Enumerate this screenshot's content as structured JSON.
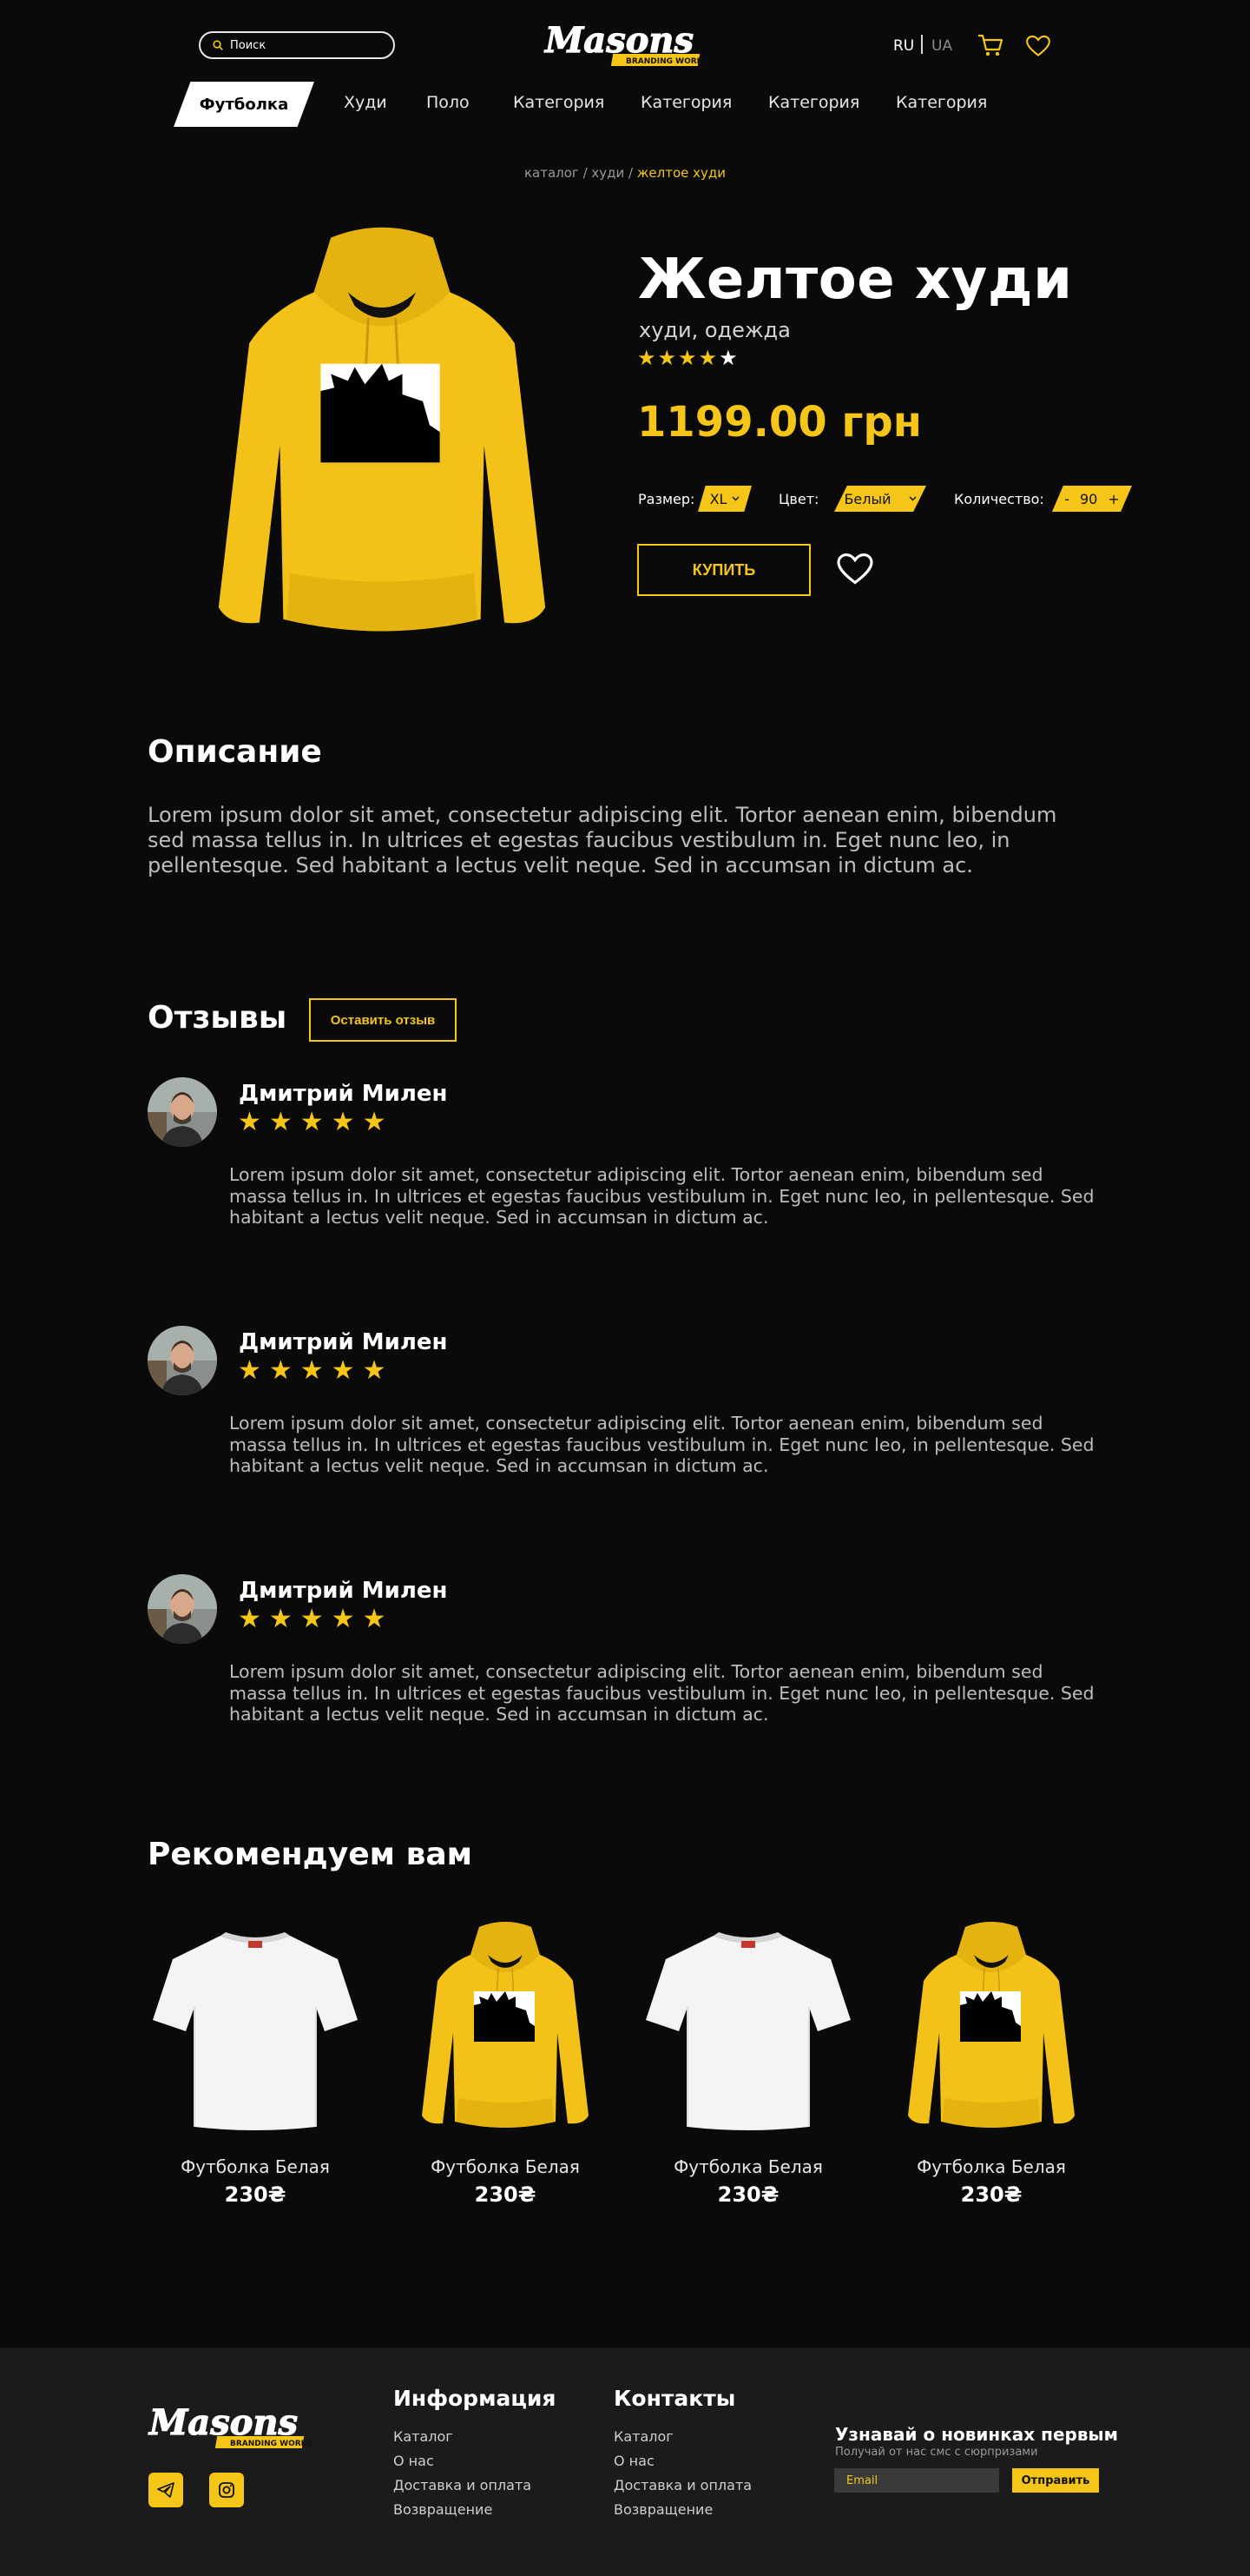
{
  "header": {
    "search_placeholder": "Поиск",
    "logo_text": "Masons",
    "logo_tagline": "BRANDING WORKSHOP",
    "lang_active": "RU",
    "lang_inactive": "UA"
  },
  "nav": {
    "active": "Футболка",
    "items": [
      "Худи",
      "Поло",
      "Категория",
      "Категория",
      "Категория",
      "Категория"
    ]
  },
  "breadcrumbs": {
    "items": [
      "каталог",
      "худи"
    ],
    "separator": " / ",
    "current": "желтое худи"
  },
  "product": {
    "title": "Желтое худи",
    "subtitle": "худи, одежда",
    "rating": 4,
    "rating_max": 5,
    "price": "1199.00 грн",
    "size_label": "Размер:",
    "size_value": "XL",
    "color_label": "Цвет:",
    "color_value": "Белый",
    "qty_label": "Количество:",
    "qty_minus": "-",
    "qty_value": "90",
    "qty_plus": "+",
    "buy_label": "КУПИТЬ"
  },
  "description": {
    "heading": "Описание",
    "text": "Lorem ipsum dolor sit amet, consectetur adipiscing elit. Tortor aenean enim, bibendum sed massa tellus in. In ultrices et egestas faucibus vestibulum in. Eget nunc leo, in pellentesque. Sed habitant a lectus velit neque. Sed in accumsan in dictum ac."
  },
  "reviews": {
    "heading": "Отзывы",
    "leave_label": "Оставить отзыв",
    "items": [
      {
        "name": "Дмитрий Милен",
        "stars": "★★★★★",
        "text": "Lorem ipsum dolor sit amet, consectetur adipiscing elit. Tortor aenean enim, bibendum sed massa tellus in. In ultrices et egestas faucibus vestibulum in. Eget nunc leo, in pellentesque. Sed habitant a lectus velit neque. Sed in accumsan in dictum ac."
      },
      {
        "name": "Дмитрий Милен",
        "stars": "★★★★★",
        "text": "Lorem ipsum dolor sit amet, consectetur adipiscing elit. Tortor aenean enim, bibendum sed massa tellus in. In ultrices et egestas faucibus vestibulum in. Eget nunc leo, in pellentesque. Sed habitant a lectus velit neque. Sed in accumsan in dictum ac."
      },
      {
        "name": "Дмитрий Милен",
        "stars": "★★★★★",
        "text": "Lorem ipsum dolor sit amet, consectetur adipiscing elit. Tortor aenean enim, bibendum sed massa tellus in. In ultrices et egestas faucibus vestibulum in. Eget nunc leo, in pellentesque. Sed habitant a lectus velit neque. Sed in accumsan in dictum ac."
      }
    ]
  },
  "recommend": {
    "heading": "Рекомендуем вам",
    "items": [
      {
        "name": "Футболка Белая",
        "price": "230₴",
        "kind": "tshirt"
      },
      {
        "name": "Футболка Белая",
        "price": "230₴",
        "kind": "hoodie"
      },
      {
        "name": "Футболка Белая",
        "price": "230₴",
        "kind": "tshirt"
      },
      {
        "name": "Футболка Белая",
        "price": "230₴",
        "kind": "hoodie"
      }
    ]
  },
  "footer": {
    "info_heading": "Информация",
    "info_links": [
      "Каталог",
      "О нас",
      "Доставка и оплата",
      "Возвращение"
    ],
    "contacts_heading": "Контакты",
    "contacts_links": [
      "Каталог",
      "О нас",
      "Доставка и оплата",
      "Возвращение"
    ],
    "news_heading": "Узнавай о новинках первым",
    "news_sub": "Получай от нас смс с сюрпризами",
    "email_placeholder": "Email",
    "send_label": "Отправить"
  },
  "colors": {
    "accent": "#f5c518",
    "background": "#0a0a0a",
    "footer": "#1b1b1b"
  },
  "icons": [
    "search-icon",
    "cart-icon",
    "heart-icon",
    "telegram-icon",
    "instagram-icon",
    "chevron-down-icon",
    "star-icon"
  ]
}
